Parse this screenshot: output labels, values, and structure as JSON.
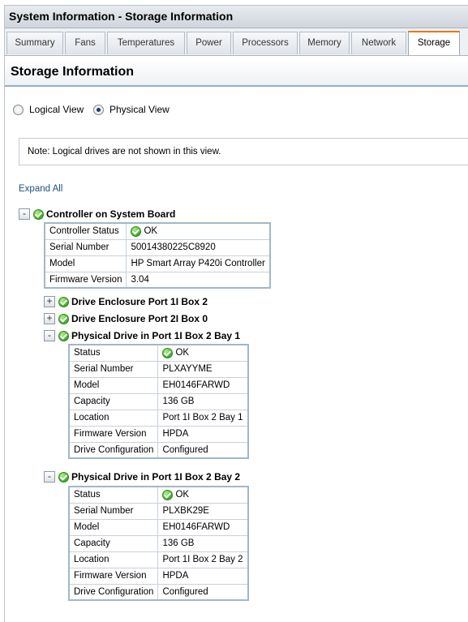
{
  "window": {
    "title": "System Information - Storage Information"
  },
  "tabs": [
    {
      "label": "Summary"
    },
    {
      "label": "Fans"
    },
    {
      "label": "Temperatures"
    },
    {
      "label": "Power"
    },
    {
      "label": "Processors"
    },
    {
      "label": "Memory"
    },
    {
      "label": "Network"
    },
    {
      "label": "Storage"
    }
  ],
  "active_tab": "Storage",
  "page": {
    "heading": "Storage Information"
  },
  "view_options": {
    "logical_label": "Logical View",
    "physical_label": "Physical View",
    "selected": "Physical View"
  },
  "note": "Note: Logical drives are not shown in this view.",
  "expand_all": "Expand All",
  "controller": {
    "label": "Controller on System Board",
    "toggle": "-",
    "rows": [
      {
        "key": "Controller Status",
        "value": "OK",
        "icon": "ok-icon"
      },
      {
        "key": "Serial Number",
        "value": "50014380225C8920"
      },
      {
        "key": "Model",
        "value": "HP Smart Array P420i Controller"
      },
      {
        "key": "Firmware Version",
        "value": "3.04"
      }
    ]
  },
  "enclosures": [
    {
      "label": "Drive Enclosure Port 1I Box 2",
      "toggle": "+"
    },
    {
      "label": "Drive Enclosure Port 2I Box 0",
      "toggle": "+"
    }
  ],
  "drives": [
    {
      "label": "Physical Drive in Port 1I Box 2 Bay 1",
      "toggle": "-",
      "rows": [
        {
          "key": "Status",
          "value": "OK",
          "icon": "ok-icon"
        },
        {
          "key": "Serial Number",
          "value": "PLXAYYME"
        },
        {
          "key": "Model",
          "value": "EH0146FARWD"
        },
        {
          "key": "Capacity",
          "value": "136 GB"
        },
        {
          "key": "Location",
          "value": "Port 1I Box 2 Bay 1"
        },
        {
          "key": "Firmware Version",
          "value": "HPDA"
        },
        {
          "key": "Drive Configuration",
          "value": "Configured"
        }
      ]
    },
    {
      "label": "Physical Drive in Port 1I Box 2 Bay 2",
      "toggle": "-",
      "rows": [
        {
          "key": "Status",
          "value": "OK",
          "icon": "ok-icon"
        },
        {
          "key": "Serial Number",
          "value": "PLXBK29E"
        },
        {
          "key": "Model",
          "value": "EH0146FARWD"
        },
        {
          "key": "Capacity",
          "value": "136 GB"
        },
        {
          "key": "Location",
          "value": "Port 1I Box 2 Bay 2"
        },
        {
          "key": "Firmware Version",
          "value": "HPDA"
        },
        {
          "key": "Drive Configuration",
          "value": "Configured"
        }
      ]
    }
  ],
  "colors": {
    "ok_green": "#3fa82a",
    "active_tab_accent": "#e07b00",
    "link": "#1f4f7f"
  }
}
